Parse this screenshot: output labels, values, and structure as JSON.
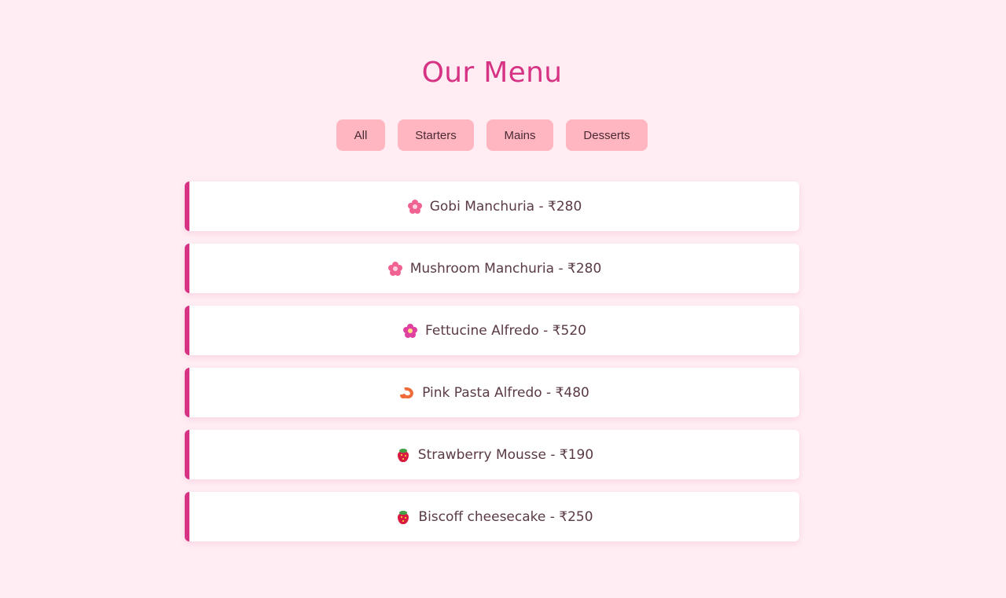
{
  "page": {
    "title": "Our Menu"
  },
  "filters": [
    {
      "label": "All"
    },
    {
      "label": "Starters"
    },
    {
      "label": "Mains"
    },
    {
      "label": "Desserts"
    }
  ],
  "menu_items": [
    {
      "icon": "cherry-blossom-icon",
      "text": "Gobi Manchuria - ₹280"
    },
    {
      "icon": "cherry-blossom-icon",
      "text": "Mushroom Manchuria - ₹280"
    },
    {
      "icon": "hibiscus-icon",
      "text": "Fettucine Alfredo - ₹520"
    },
    {
      "icon": "shrimp-icon",
      "text": "Pink Pasta Alfredo - ₹480"
    },
    {
      "icon": "strawberry-icon",
      "text": "Strawberry Mousse - ₹190"
    },
    {
      "icon": "strawberry-icon",
      "text": "Biscoff cheesecake - ₹250"
    }
  ],
  "colors": {
    "background": "#ffedf3",
    "accent": "#d63384",
    "button": "#ffb6c1",
    "card": "#ffffff"
  }
}
